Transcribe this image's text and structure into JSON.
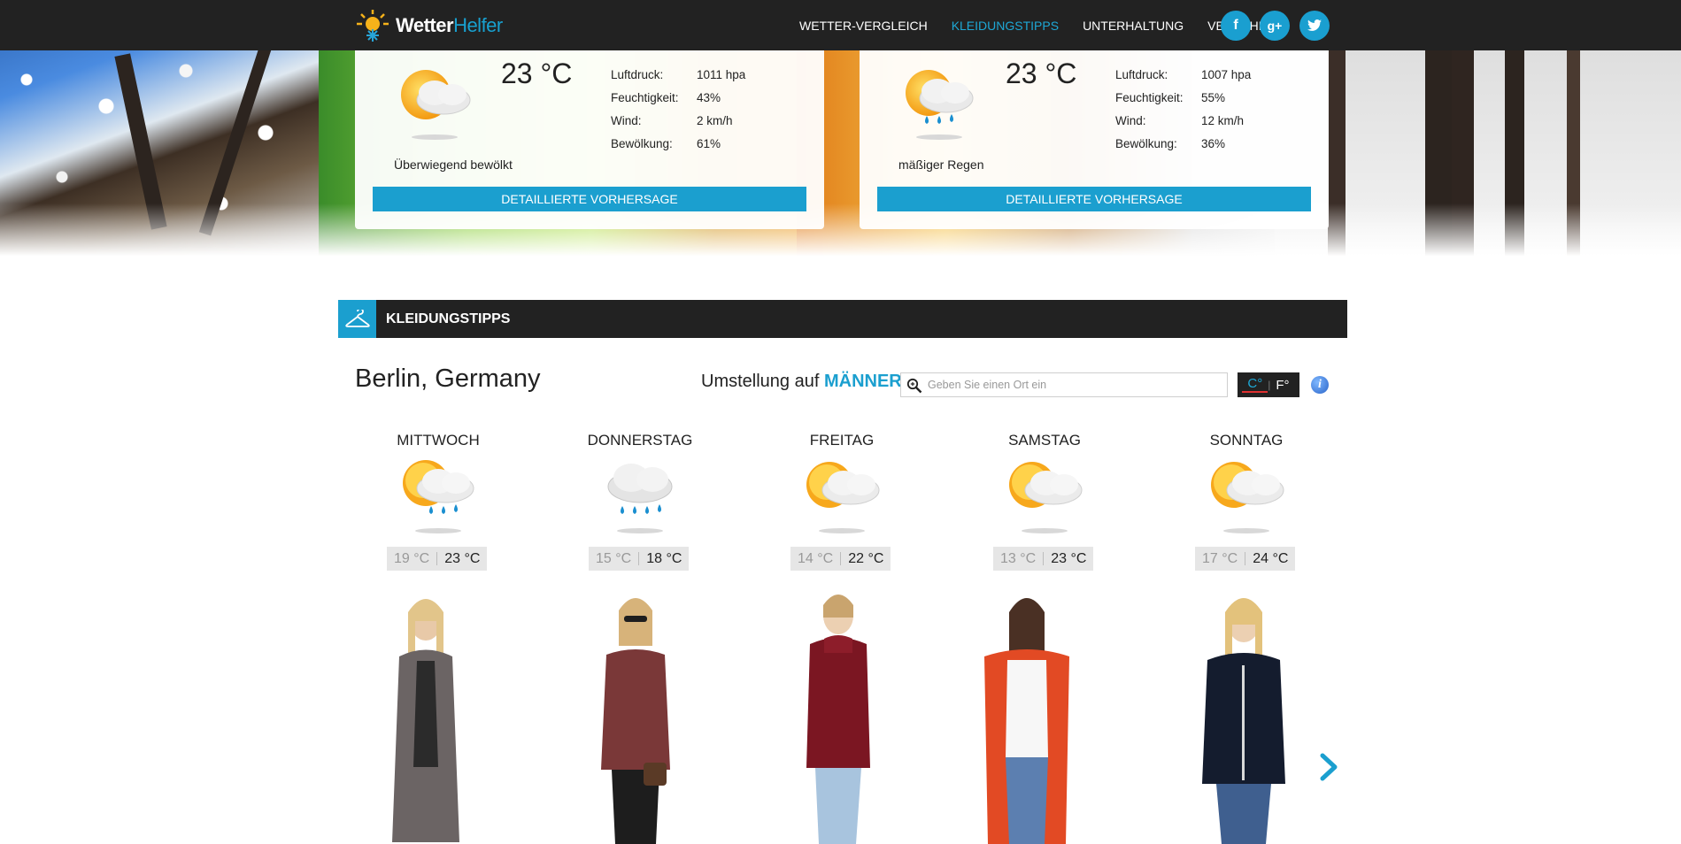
{
  "brand": {
    "name_bold": "Wetter",
    "name_light": "Helfer"
  },
  "nav": {
    "items": [
      {
        "label": "WETTER-VERGLEICH",
        "active": false
      },
      {
        "label": "KLEIDUNGSTIPPS",
        "active": true
      },
      {
        "label": "UNTERHALTUNG",
        "active": false
      },
      {
        "label": "VERKEHR",
        "active": false
      }
    ],
    "social": [
      "facebook-icon",
      "google-plus-icon",
      "twitter-icon"
    ],
    "social_glyphs": [
      "f",
      "g+",
      "t"
    ]
  },
  "cards": [
    {
      "temp": "23 °C",
      "icon": "partly-cloudy-icon",
      "description": "Überwiegend bewölkt",
      "details": [
        {
          "label": "Luftdruck:",
          "value": "1011 hpa"
        },
        {
          "label": "Feuchtigkeit:",
          "value": "43%"
        },
        {
          "label": "Wind:",
          "value": "2 km/h"
        },
        {
          "label": "Bewölkung:",
          "value": "61%"
        }
      ],
      "button": "DETAILLIERTE VORHERSAGE"
    },
    {
      "temp": "23 °C",
      "icon": "sun-cloud-rain-icon",
      "description": "mäßiger Regen",
      "details": [
        {
          "label": "Luftdruck:",
          "value": "1007 hpa"
        },
        {
          "label": "Feuchtigkeit:",
          "value": "55%"
        },
        {
          "label": "Wind:",
          "value": "12 km/h"
        },
        {
          "label": "Bewölkung:",
          "value": "36%"
        }
      ],
      "button": "DETAILLIERTE VORHERSAGE"
    }
  ],
  "section": {
    "title": "KLEIDUNGSTIPPS",
    "icon": "hanger-icon"
  },
  "location": {
    "city": "Berlin, Germany"
  },
  "gender_switch": {
    "prefix": "Umstellung auf",
    "target": "MÄNNER"
  },
  "search": {
    "placeholder": "Geben Sie einen Ort ein",
    "value": ""
  },
  "units": {
    "celsius": "C°",
    "fahrenheit": "F°",
    "selected": "C°"
  },
  "forecast": [
    {
      "day": "MITTWOCH",
      "icon": "sun-cloud-rain-icon",
      "min": "19 °C",
      "max": "23 °C"
    },
    {
      "day": "DONNERSTAG",
      "icon": "cloud-rain-icon",
      "min": "15 °C",
      "max": "18 °C"
    },
    {
      "day": "FREITAG",
      "icon": "partly-cloudy-icon",
      "min": "14 °C",
      "max": "22 °C"
    },
    {
      "day": "SAMSTAG",
      "icon": "partly-cloudy-icon",
      "min": "13 °C",
      "max": "23 °C"
    },
    {
      "day": "SONNTAG",
      "icon": "partly-cloudy-icon",
      "min": "17 °C",
      "max": "24 °C"
    }
  ],
  "colors": {
    "accent": "#1b9fcf",
    "nav_bg": "#222222"
  }
}
